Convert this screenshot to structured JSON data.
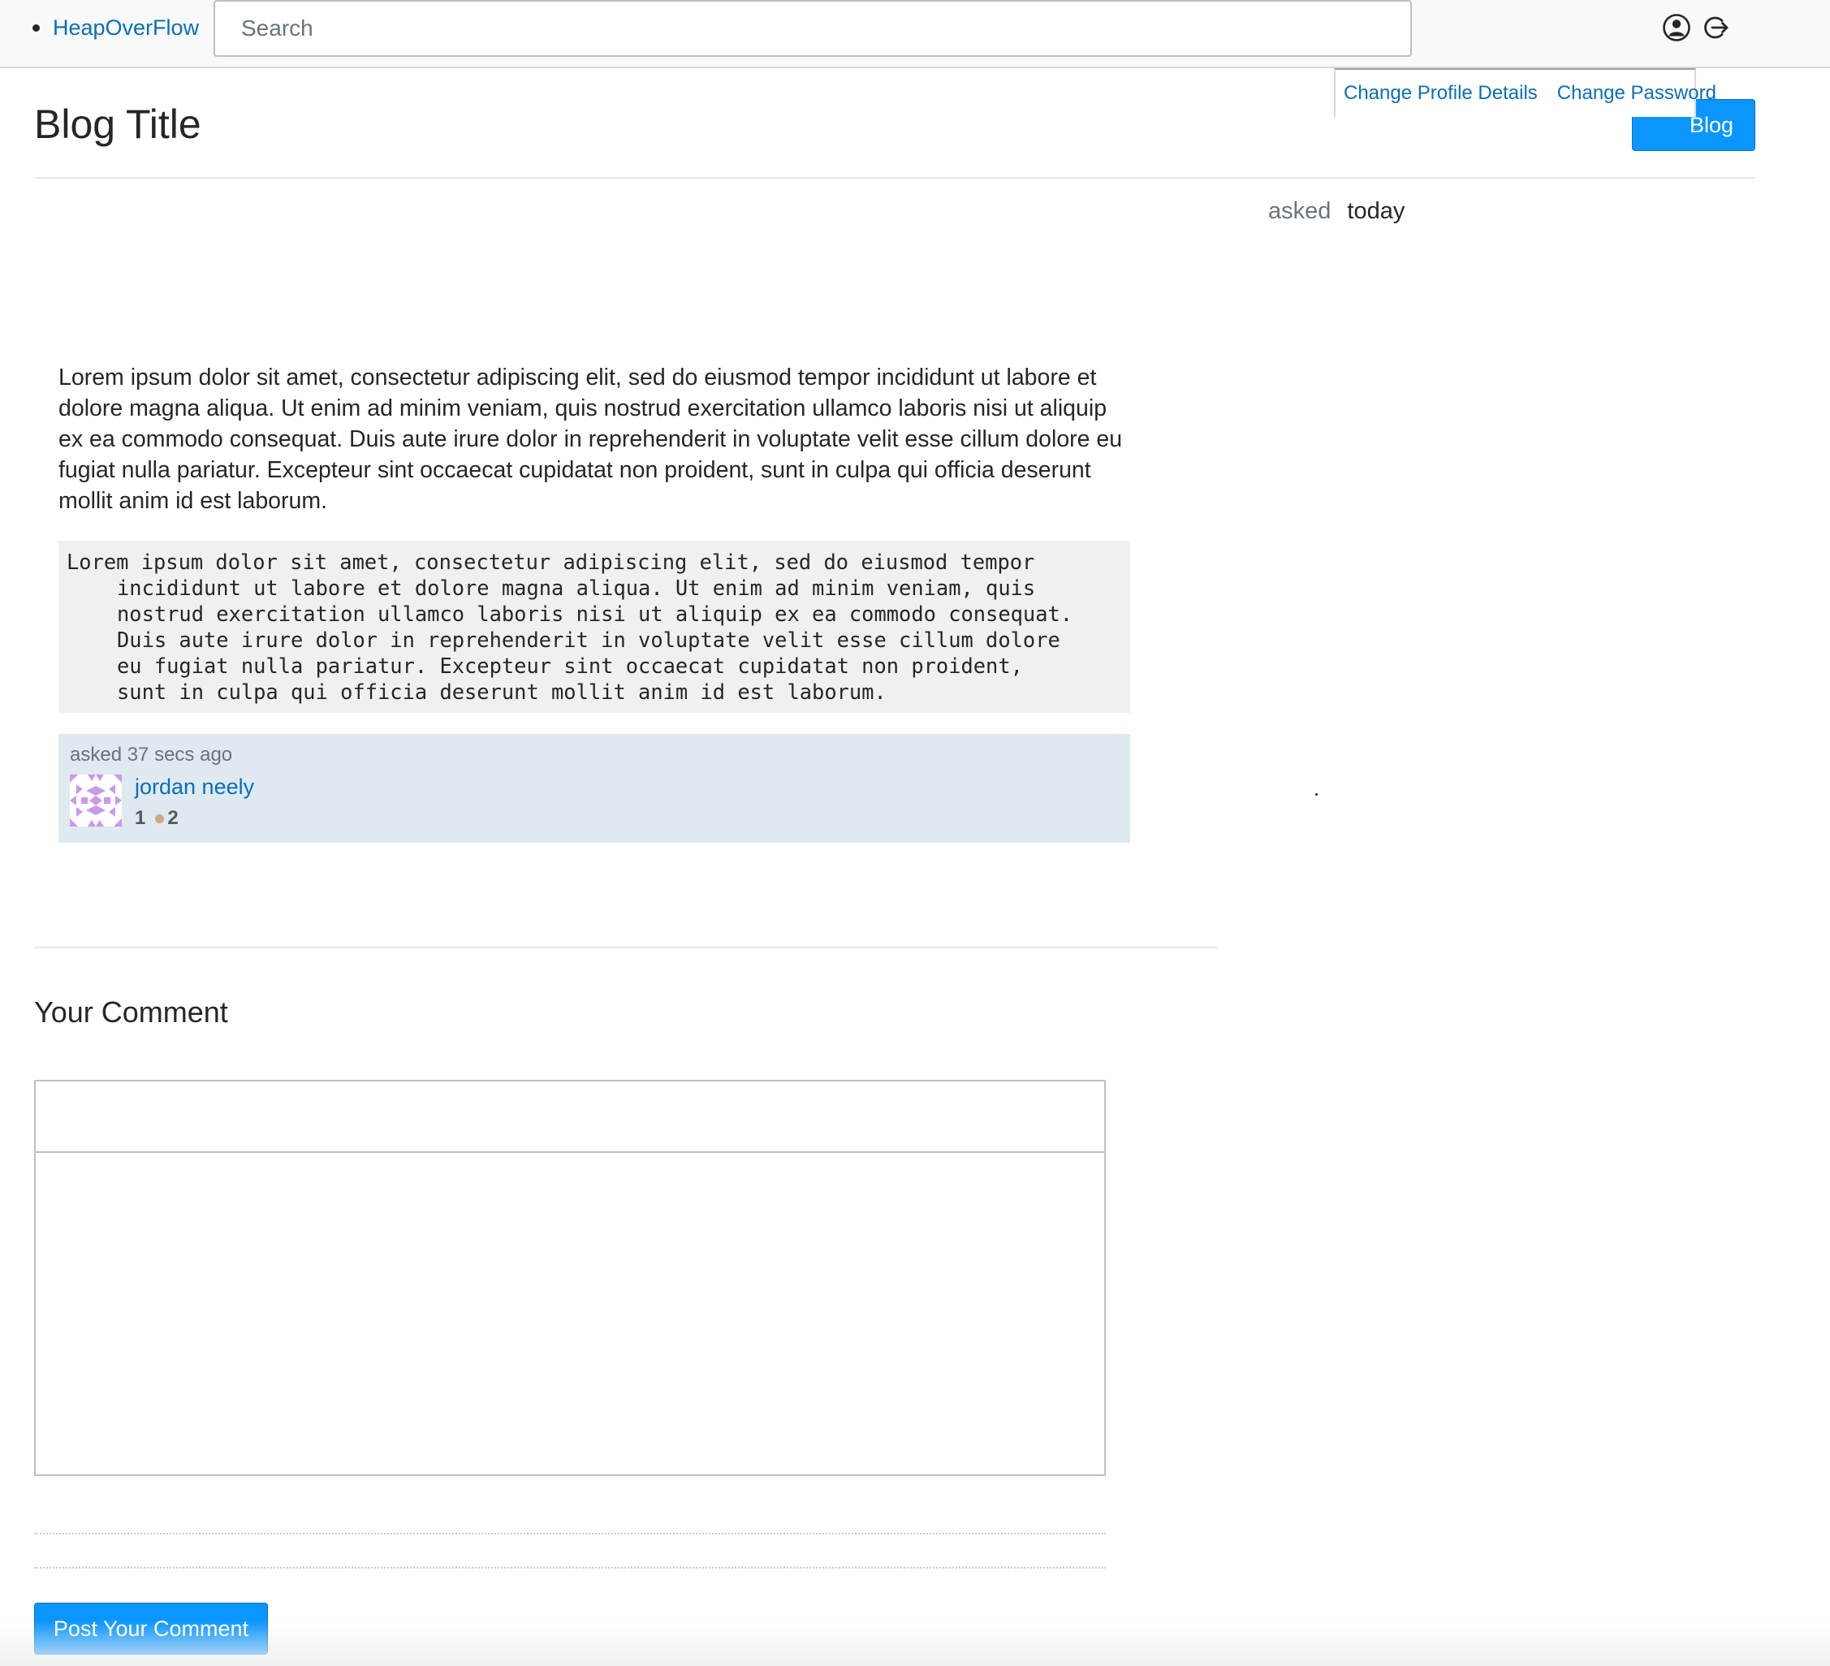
{
  "topbar": {
    "brand": "HeapOverFlow",
    "search_placeholder": "Search",
    "icons": [
      "user-circle-icon",
      "logout-icon"
    ]
  },
  "profile_menu": {
    "items": [
      "Change Profile Details",
      "Change Password"
    ]
  },
  "header": {
    "title": "Blog Title",
    "new_blog_label": "Blog"
  },
  "meta": {
    "asked_label": "asked",
    "asked_value": "today"
  },
  "post": {
    "body": "Lorem ipsum dolor sit amet, consectetur adipiscing elit, sed do eiusmod tempor incididunt ut labore et dolore magna aliqua. Ut enim ad minim veniam, quis nostrud exercitation ullamco laboris nisi ut aliquip ex ea commodo consequat. Duis aute irure dolor in reprehenderit in voluptate velit esse cillum dolore eu fugiat nulla pariatur. Excepteur sint occaecat cupidatat non proident, sunt in culpa qui officia deserunt mollit anim id est laborum.",
    "code_lines": [
      "Lorem ipsum dolor sit amet, consectetur adipiscing elit, sed do eiusmod tempor",
      "incididunt ut labore et dolore magna aliqua. Ut enim ad minim veniam, quis",
      "nostrud exercitation ullamco laboris nisi ut aliquip ex ea commodo consequat.",
      "Duis aute irure dolor in reprehenderit in voluptate velit esse cillum dolore",
      "eu fugiat nulla pariatur. Excepteur sint occaecat cupidatat non proident,",
      "sunt in culpa qui officia deserunt mollit anim id est laborum."
    ]
  },
  "author": {
    "asked_text": "asked 37 secs ago",
    "name": "jordan neely",
    "reputation": "1",
    "bronze_badges": "2"
  },
  "comment": {
    "heading": "Your Comment",
    "submit_label": "Post Your Comment"
  },
  "colors": {
    "link": "#0a6fb8",
    "primary_button": "#0a95ff",
    "user_card_bg": "#dfe9f0",
    "code_bg": "#eff0f1",
    "bronze_badge": "#d1a684"
  }
}
